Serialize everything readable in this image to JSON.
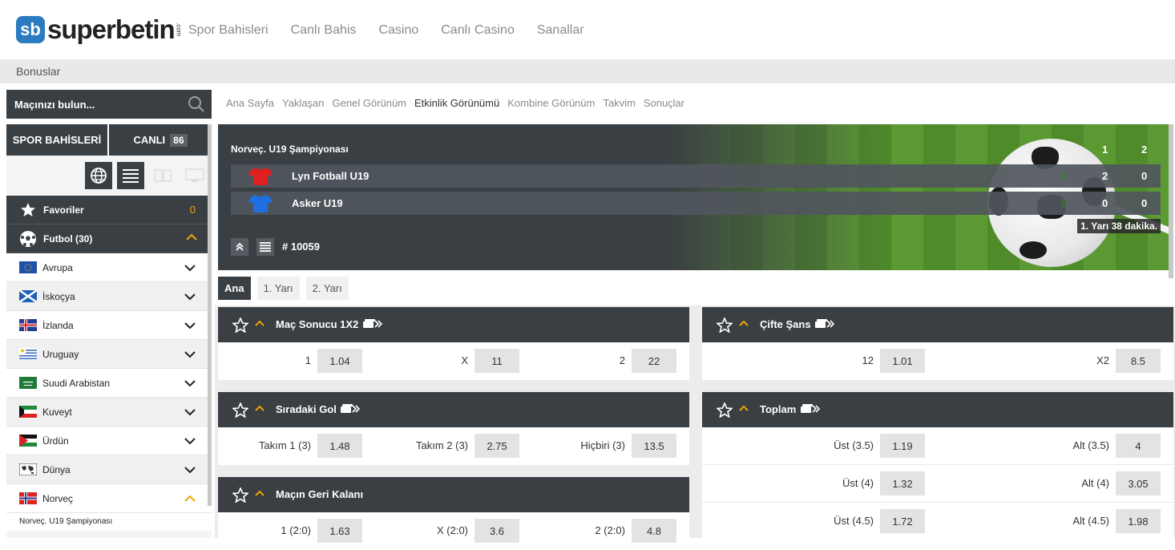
{
  "brand": {
    "sb": "sb",
    "name": "superbetin",
    "com": ".com"
  },
  "topnav": [
    "Spor Bahisleri",
    "Canlı Bahis",
    "Casino",
    "Canlı Casino",
    "Sanallar"
  ],
  "subnav": {
    "bonuses": "Bonuslar"
  },
  "search": {
    "placeholder": "Maçınızı bulun..."
  },
  "sidebar": {
    "tab_sports": "SPOR BAHİSLERİ",
    "tab_live": "CANLI",
    "live_count": "86",
    "favorites": {
      "label": "Favoriler",
      "count": "0"
    },
    "football": {
      "label": "Futbol (30)"
    },
    "countries": [
      "Avrupa",
      "İskoçya",
      "İzlanda",
      "Uruguay",
      "Suudi Arabistan",
      "Kuveyt",
      "Ürdün",
      "Dünya",
      "Norveç"
    ],
    "sub_league": "Norveç. U19 Şampiyonası"
  },
  "breadcrumb": [
    "Ana Sayfa",
    "Yaklaşan",
    "Genel Görünüm",
    "Etkinlik Görünümü",
    "Kombine Görünüm",
    "Takvim",
    "Sonuçlar"
  ],
  "event": {
    "league": "Norveç. U19 Şampiyonası",
    "col1": "1",
    "col2": "2",
    "home": {
      "name": "Lyn Fotball U19",
      "score": "2",
      "h1": "2",
      "h2": "0",
      "color": "#e02020"
    },
    "away": {
      "name": "Asker U19",
      "score": "0",
      "h1": "0",
      "h2": "0",
      "color": "#1f6fe0"
    },
    "period": "1. Yarı",
    "minute": "38 dakika.",
    "id": "# 10059"
  },
  "period_tabs": [
    "Ana",
    "1. Yarı",
    "2. Yarı"
  ],
  "markets": {
    "result": {
      "title": "Maç Sonucu 1X2",
      "o": [
        {
          "l": "1",
          "v": "1.04"
        },
        {
          "l": "X",
          "v": "11"
        },
        {
          "l": "2",
          "v": "22"
        }
      ]
    },
    "double": {
      "title": "Çifte Şans",
      "o": [
        {
          "l": "12",
          "v": "1.01"
        },
        {
          "l": "X2",
          "v": "8.5"
        }
      ]
    },
    "next_goal": {
      "title": "Sıradaki Gol",
      "o": [
        {
          "l": "Takım 1 (3)",
          "v": "1.48"
        },
        {
          "l": "Takım 2 (3)",
          "v": "2.75"
        },
        {
          "l": "Hiçbiri (3)",
          "v": "13.5"
        }
      ]
    },
    "total": {
      "title": "Toplam",
      "rows": [
        [
          {
            "l": "Üst (3.5)",
            "v": "1.19"
          },
          {
            "l": "Alt (3.5)",
            "v": "4"
          }
        ],
        [
          {
            "l": "Üst (4)",
            "v": "1.32"
          },
          {
            "l": "Alt (4)",
            "v": "3.05"
          }
        ],
        [
          {
            "l": "Üst (4.5)",
            "v": "1.72"
          },
          {
            "l": "Alt (4.5)",
            "v": "1.98"
          }
        ]
      ]
    },
    "rest": {
      "title": "Maçın Geri Kalanı",
      "o": [
        {
          "l": "1 (2:0)",
          "v": "1.63"
        },
        {
          "l": "X (2:0)",
          "v": "3.6"
        },
        {
          "l": "2 (2:0)",
          "v": "4.8"
        }
      ]
    }
  },
  "colors": {
    "dark": "#3a3f44",
    "accent": "#f0a500"
  }
}
